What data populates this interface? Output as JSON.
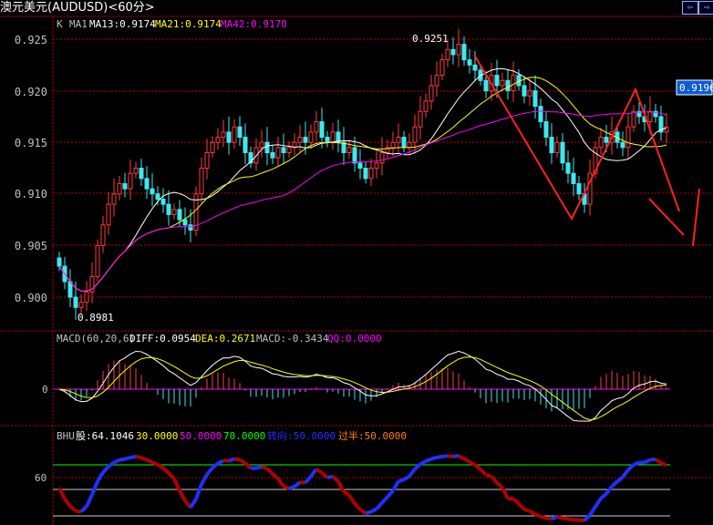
{
  "title": "澳元美元(AUDUSD)<60分>",
  "nav": {
    "prev": "⇦",
    "next": "⇨"
  },
  "colors": {
    "up": "#ff3b3b",
    "down": "#3ee8f0",
    "ma13": "#ffffff",
    "ma21": "#ffff00",
    "ma42": "#ff00ff",
    "grid": "#c00000",
    "axis": "#c0c0c0"
  },
  "main": {
    "legend": {
      "k": "K",
      "ma1": "MA1",
      "ma13": "MA13:0.9174",
      "ma21": "MA21:0.9174",
      "ma42": "MA42:0.9170"
    },
    "high_label": "0.9251",
    "low_label": "0.8981",
    "last_price": "0.9196",
    "y_ticks": [
      "0.925",
      "0.920",
      "0.915",
      "0.910",
      "0.905",
      "0.900"
    ]
  },
  "macd": {
    "title": "MACD(60,20,6)",
    "diff": "DIFF:0.0954",
    "dea": "DEA:0.2671",
    "macd": "MACD:-0.3434",
    "qq": "QQ:0.0000",
    "zero_tick": "0"
  },
  "bhu": {
    "title": "BHU",
    "gu": "股:64.1046",
    "v30": "30.0000",
    "v50": "50.0000",
    "v70": "70.0000",
    "turn": "转向:50.0000",
    "half": "过半:50.0000",
    "tick": "60"
  },
  "chart_data": {
    "type": "candlestick",
    "ylim": [
      0.8975,
      0.9265
    ],
    "closes": [
      0.903,
      0.9015,
      0.9,
      0.899,
      0.8995,
      0.9005,
      0.902,
      0.905,
      0.907,
      0.909,
      0.91,
      0.911,
      0.9105,
      0.912,
      0.9125,
      0.9115,
      0.9105,
      0.91,
      0.9095,
      0.909,
      0.908,
      0.9085,
      0.9075,
      0.907,
      0.9065,
      0.91,
      0.9125,
      0.914,
      0.915,
      0.9155,
      0.916,
      0.915,
      0.9165,
      0.9155,
      0.914,
      0.913,
      0.9145,
      0.915,
      0.914,
      0.9135,
      0.9145,
      0.914,
      0.9145,
      0.915,
      0.9155,
      0.915,
      0.916,
      0.917,
      0.9155,
      0.915,
      0.916,
      0.915,
      0.914,
      0.9145,
      0.913,
      0.9125,
      0.9115,
      0.9125,
      0.913,
      0.914,
      0.9145,
      0.915,
      0.9155,
      0.9145,
      0.915,
      0.9165,
      0.918,
      0.919,
      0.9205,
      0.9215,
      0.923,
      0.924,
      0.9235,
      0.9245,
      0.923,
      0.9225,
      0.922,
      0.921,
      0.92,
      0.9215,
      0.9205,
      0.921,
      0.92,
      0.9215,
      0.9205,
      0.9195,
      0.92,
      0.9185,
      0.917,
      0.9155,
      0.914,
      0.915,
      0.913,
      0.912,
      0.911,
      0.91,
      0.909,
      0.912,
      0.9145,
      0.9155,
      0.915,
      0.916,
      0.915,
      0.9145,
      0.9165,
      0.918,
      0.9175,
      0.917,
      0.918,
      0.9175,
      0.916,
      0.9165
    ]
  }
}
